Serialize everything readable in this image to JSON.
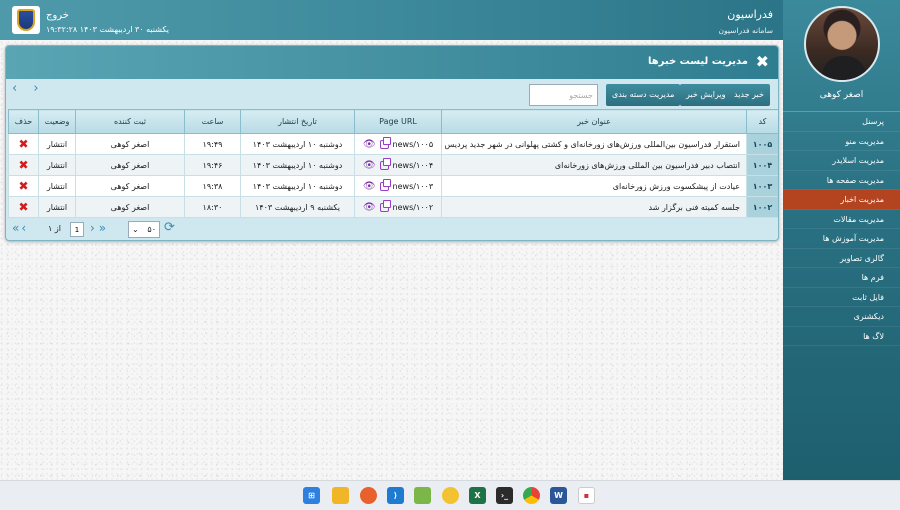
{
  "header": {
    "app_title": "فدراسیون",
    "app_subtitle": "سامانه فدراسیون",
    "exit_label": "خروج",
    "datetime": "یکشنبه ۳۰ اردیبهشت ۱۴۰۳  ۱۹:۳۲:۲۸"
  },
  "sidebar": {
    "user_name": "اصغر کوهی",
    "items": [
      {
        "label": "پرسنل"
      },
      {
        "label": "مدیریت منو"
      },
      {
        "label": "مدیریت اسلایدر"
      },
      {
        "label": "مدیریت صفحه ها"
      },
      {
        "label": "مدیریت اخبار"
      },
      {
        "label": "مدیریت مقالات"
      },
      {
        "label": "مدیریت آموزش ها"
      },
      {
        "label": "گالری تصاویر"
      },
      {
        "label": "فرم ها"
      },
      {
        "label": "فایل ثابت"
      },
      {
        "label": "دیکشنری"
      },
      {
        "label": "لاگ ها"
      }
    ],
    "active_index": 4
  },
  "panel": {
    "title": "مدیریت لیست خبرها",
    "buttons": {
      "new_news": "خبر جدید",
      "edit_news": "ویرایش خبر",
      "manage_categories": "مدیریت دسته بندی"
    },
    "search_placeholder": "جستجو",
    "columns": [
      "کد",
      "عنوان خبر",
      "Page URL",
      "تاریخ انتشار",
      "ساعت",
      "ثبت کننده",
      "وضعیت",
      "حذف"
    ],
    "rows": [
      {
        "id": "۱۰۰۵",
        "title": "استقرار فدراسیون بین‌المللی ورزش‌های زورخانه‌ای و کشتی پهلوانی در شهر جدید پردیس",
        "url": "news/۱۰۰۵",
        "date": "دوشنبه ۱۰ اردیبهشت ۱۴۰۳",
        "time": "۱۹:۴۹",
        "author": "اصغر کوهی",
        "status": "انتشار"
      },
      {
        "id": "۱۰۰۴",
        "title": "انتصاب دبیر فدراسیون بین المللی ورزش‌های زورخانه‌ای",
        "url": "news/۱۰۰۴",
        "date": "دوشنبه ۱۰ اردیبهشت ۱۴۰۳",
        "time": "۱۹:۴۶",
        "author": "اصغر کوهی",
        "status": "انتشار"
      },
      {
        "id": "۱۰۰۳",
        "title": "عیادت از پیشکسوت ورزش زورخانه‌ای",
        "url": "news/۱۰۰۳",
        "date": "دوشنبه ۱۰ اردیبهشت ۱۴۰۳",
        "time": "۱۹:۳۸",
        "author": "اصغر کوهی",
        "status": "انتشار"
      },
      {
        "id": "۱۰۰۲",
        "title": "جلسه کمیته فنی برگزار شد",
        "url": "news/۱۰۰۲",
        "date": "یکشنبه ۹ اردیبهشت ۱۴۰۳",
        "time": "۱۸:۳۰",
        "author": "اصغر کوهی",
        "status": "انتشار"
      }
    ],
    "pager": {
      "page_value": "1",
      "of_text": "از ۱",
      "page_size": "۵۰"
    }
  },
  "taskbar": {
    "apps": [
      "windows-start",
      "file-explorer",
      "firefox",
      "vscode",
      "notepadpp",
      "app-yellow",
      "excel",
      "terminal",
      "chrome",
      "word",
      "app-red"
    ]
  }
}
